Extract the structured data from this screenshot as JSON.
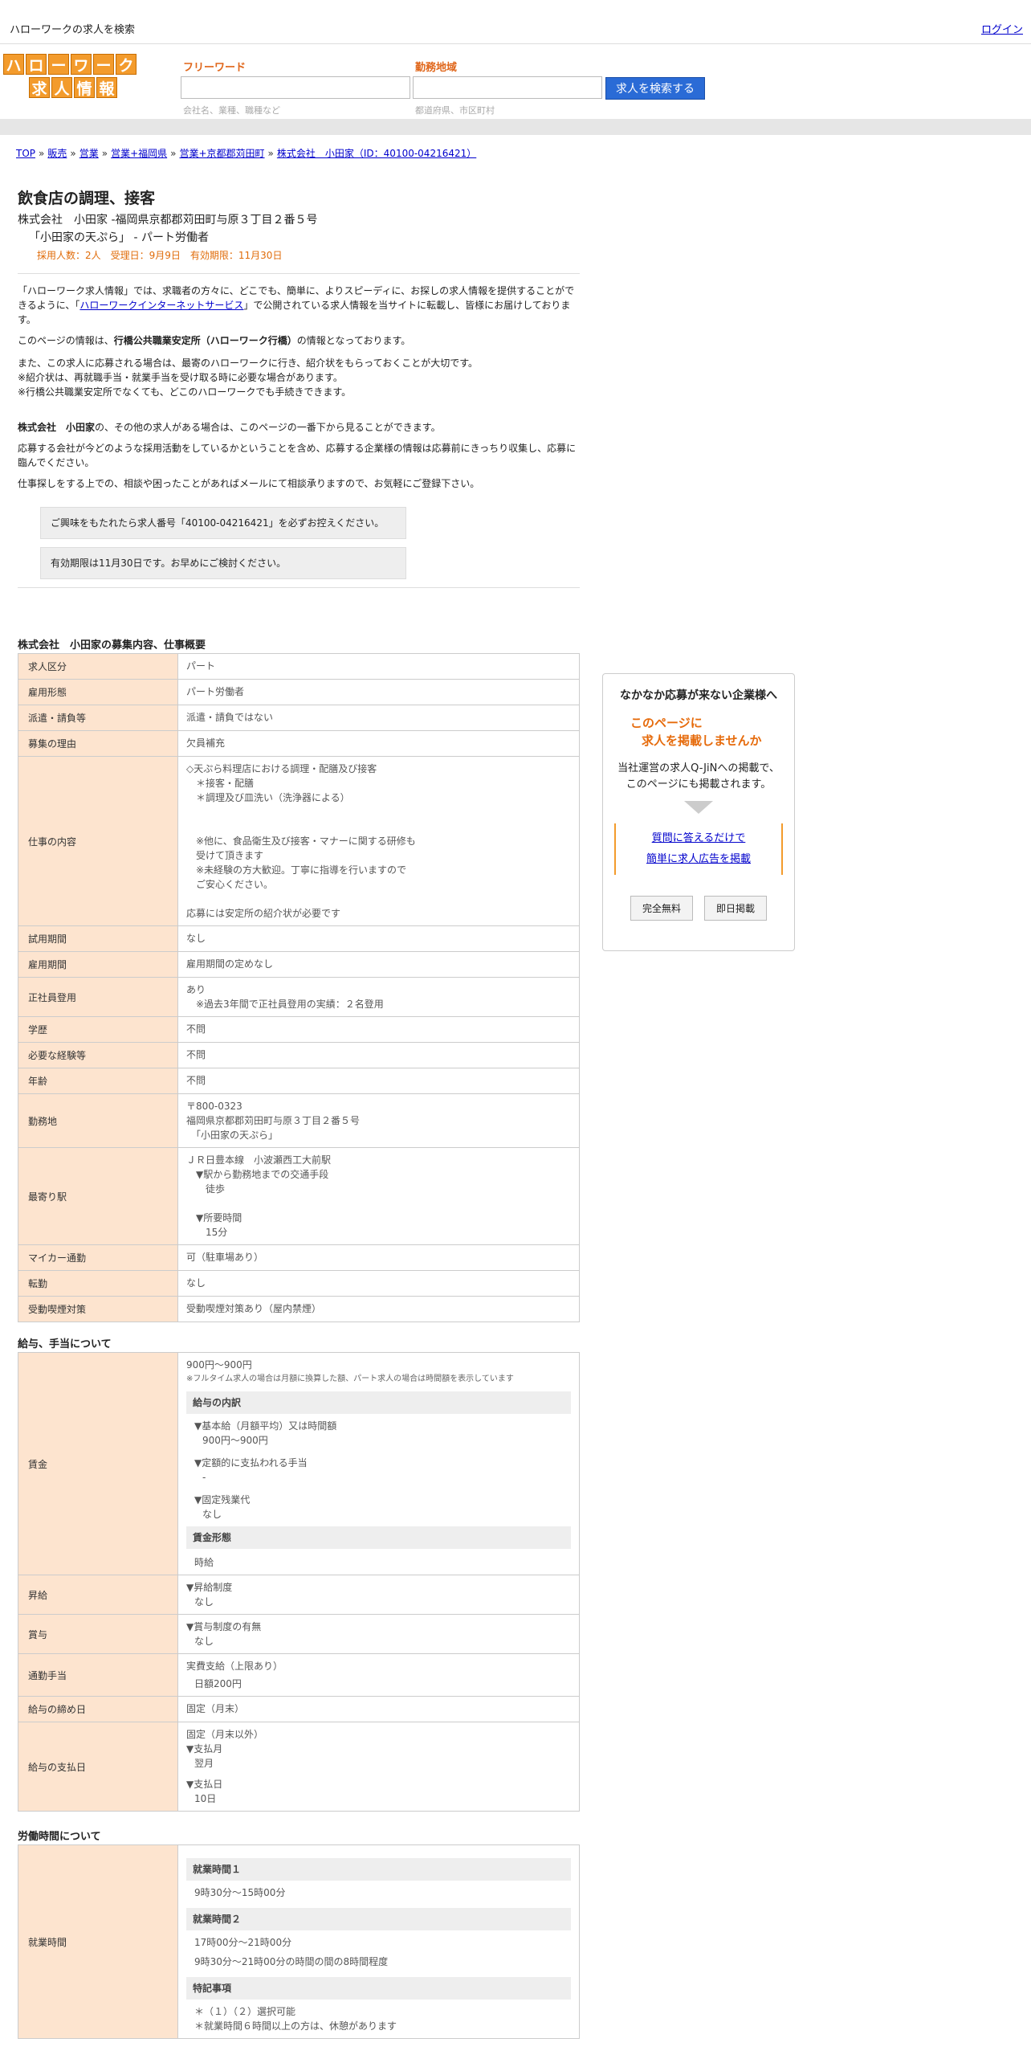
{
  "topbar": {
    "site_title": "ハローワークの求人を検索",
    "login": "ログイン"
  },
  "logo": {
    "row1": [
      "ハ",
      "ロ",
      "ー",
      "ワ",
      "ー",
      "ク"
    ],
    "row2": [
      "求",
      "人",
      "情",
      "報"
    ]
  },
  "search": {
    "keyword_label": "フリーワード",
    "keyword_placeholder": "会社名、業種、職種など",
    "area_label": "勤務地域",
    "area_placeholder": "都道府県、市区町村",
    "button": "求人を検索する"
  },
  "breadcrumb": [
    "TOP",
    "販売",
    "営業",
    "営業+福岡県",
    "営業+京都郡苅田町",
    "株式会社　小田家（ID：40100-04216421）"
  ],
  "job": {
    "title": "飲食店の調理、接客",
    "company_line": "株式会社　小田家 -福岡県京都郡苅田町与原３丁目２番５号",
    "store_line": "「小田家の天ぷら」 - パート労働者",
    "meta": "採用人数：2人　受理日：9月9日　有効期限：11月30日"
  },
  "intro": {
    "p1a": "「ハローワーク求人情報」では、求職者の方々に、どこでも、簡単に、よりスピーディに、お探しの求人情報を提供することができるように、「",
    "p1_link": "ハローワークインターネットサービス",
    "p1b": "」で公開されている求人情報を当サイトに転載し、皆様にお届けしております。",
    "p2a": "このページの情報は、",
    "p2_bold": "行橋公共職業安定所（ハローワーク行橋）",
    "p2b": "の情報となっております。",
    "p3": "また、この求人に応募される場合は、最寄のハローワークに行き、紹介状をもらっておくことが大切です。",
    "p4": "※紹介状は、再就職手当・就業手当を受け取る時に必要な場合があります。",
    "p5": "※行橋公共職業安定所でなくても、どこのハローワークでも手続きできます。",
    "p6_bold": "株式会社　小田家",
    "p6": "の、その他の求人がある場合は、このページの一番下から見ることができます。",
    "p7": "応募する会社が今どのような採用活動をしているかということを含め、応募する企業様の情報は応募前にきっちり収集し、応募に臨んでください。",
    "p8": "仕事探しをする上での、相談や困ったことがあればメールにて相談承りますので、お気軽にご登録下さい。",
    "notice1": "ご興味をもたれたら求人番号「40100-04216421」を必ずお控えください。",
    "notice2": "有効期限は11月30日です。お早めにご検討ください。"
  },
  "summary": {
    "title": "株式会社　小田家の募集内容、仕事概要",
    "rows": [
      {
        "h": "求人区分",
        "v": [
          "パート"
        ]
      },
      {
        "h": "雇用形態",
        "v": [
          "パート労働者"
        ]
      },
      {
        "h": "派遣・請負等",
        "v": [
          "派遣・請負ではない"
        ]
      },
      {
        "h": "募集の理由",
        "v": [
          "欠員補充"
        ]
      },
      {
        "h": "仕事の内容",
        "v": [
          "◇天ぷら料理店における調理・配膳及び接客",
          "　＊接客・配膳",
          "　＊調理及び皿洗い（洗浄器による）",
          "",
          "",
          "　※他に、食品衛生及び接客・マナーに関する研修も",
          "　受けて頂きます",
          "　※未経験の方大歓迎。丁寧に指導を行いますので",
          "　ご安心ください。",
          "",
          "応募には安定所の紹介状が必要です"
        ]
      },
      {
        "h": "試用期間",
        "v": [
          "なし"
        ]
      },
      {
        "h": "雇用期間",
        "v": [
          "雇用期間の定めなし"
        ]
      },
      {
        "h": "正社員登用",
        "v": [
          "あり",
          "　※過去3年間で正社員登用の実績：２名登用"
        ]
      },
      {
        "h": "学歴",
        "v": [
          "不問"
        ]
      },
      {
        "h": "必要な経験等",
        "v": [
          "不問"
        ]
      },
      {
        "h": "年齢",
        "v": [
          "不問"
        ]
      },
      {
        "h": "勤務地",
        "v": [
          "〒800-0323",
          "福岡県京都郡苅田町与原３丁目２番５号",
          "　「小田家の天ぷら」"
        ]
      },
      {
        "h": "最寄り駅",
        "v": [
          "ＪＲ日豊本線　小波瀬西工大前駅",
          "　▼駅から勤務地までの交通手段",
          "　　徒歩",
          "",
          "　▼所要時間",
          "　　15分"
        ]
      },
      {
        "h": "マイカー通勤",
        "v": [
          "可（駐車場あり）"
        ]
      },
      {
        "h": "転勤",
        "v": [
          "なし"
        ]
      },
      {
        "h": "受動喫煙対策",
        "v": [
          "受動喫煙対策あり（屋内禁煙）"
        ]
      }
    ]
  },
  "salary": {
    "title": "給与、手当について",
    "wage_label": "賃金",
    "wage_amount": "900円〜900円",
    "wage_note": "※フルタイム求人の場合は月額に換算した額、パート求人の場合は時間額を表示しています",
    "breakdown_head": "給与の内訳",
    "b1": "▼基本給（月額平均）又は時間額",
    "b1v": "900円〜900円",
    "b2": "▼定額的に支払われる手当",
    "b2v": "-",
    "b3": "▼固定残業代",
    "b3v": "なし",
    "form_head": "賃金形態",
    "form_v": "時給",
    "raise_label": "昇給",
    "raise_1": "▼昇給制度",
    "raise_2": "なし",
    "bonus_label": "賞与",
    "bonus_1": "▼賞与制度の有無",
    "bonus_2": "なし",
    "commute_label": "通勤手当",
    "commute_1": "実費支給（上限あり）",
    "commute_2": "日額200円",
    "cutoff_label": "給与の締め日",
    "cutoff_v": "固定（月末）",
    "pay_label": "給与の支払日",
    "pay_1": "固定（月末以外）",
    "pay_2": "▼支払月",
    "pay_3": "翌月",
    "pay_4": "▼支払日",
    "pay_5": "10日"
  },
  "hours": {
    "title": "労働時間について",
    "label": "就業時間",
    "h1": "就業時間１",
    "h1v": "9時30分〜15時00分",
    "h2": "就業時間２",
    "h2v1": "17時00分〜21時00分",
    "h2v2": "9時30分〜21時00分の時間の間の8時間程度",
    "h3": "特記事項",
    "h3v1": "＊（１）（２）選択可能",
    "h3v2": "＊就業時間６時間以上の方は、休憩があります"
  },
  "sidebox": {
    "heading": "なかなか応募が来ない企業様へ",
    "offer1": "このページに",
    "offer2": "求人を掲載しませんか",
    "desc1": "当社運営の求人Q-JiNへの掲載で、",
    "desc2": "このページにも掲載されます。",
    "link1": "質問に答えるだけで",
    "link2": "簡単に求人広告を掲載",
    "btn1": "完全無料",
    "btn2": "即日掲載"
  }
}
